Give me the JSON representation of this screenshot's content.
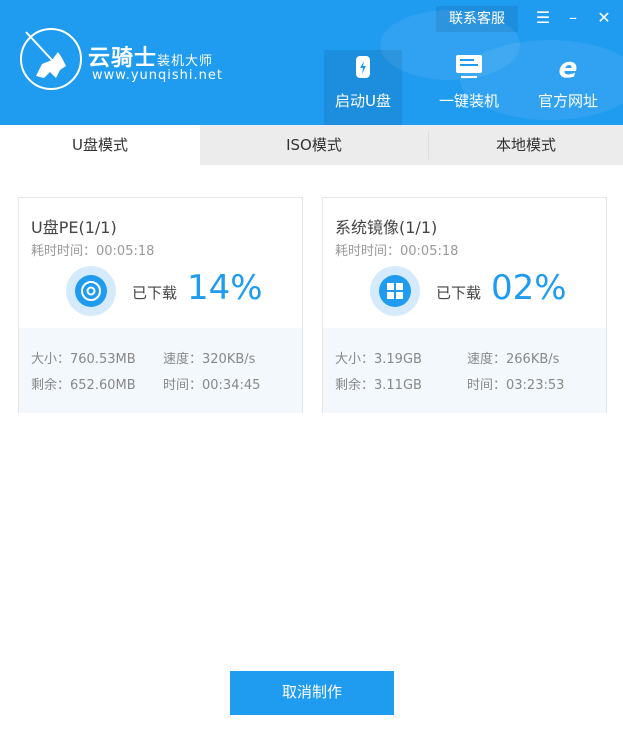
{
  "header": {
    "brand": "云骑士",
    "brand_sub": "装机大师",
    "url": "www.yunqishi.net",
    "service_label": "联系客服",
    "nav": [
      {
        "label": "启动U盘",
        "icon": "usb-icon",
        "active": true
      },
      {
        "label": "一键装机",
        "icon": "monitor-icon",
        "active": false
      },
      {
        "label": "官方网址",
        "icon": "ie-icon",
        "active": false
      }
    ]
  },
  "tabs": [
    "U盘模式",
    "ISO模式",
    "本地模式"
  ],
  "cards": [
    {
      "title": "U盘PE(1/1)",
      "elapsed": "耗时时间：00:05:18",
      "downloaded_label": "已下载",
      "percent": "14%",
      "size": "大小：760.53MB",
      "speed": "速度：320KB/s",
      "remaining": "剩余：652.60MB",
      "time": "时间：00:34:45"
    },
    {
      "title": "系统镜像(1/1)",
      "elapsed": "耗时时间：00:05:18",
      "downloaded_label": "已下载",
      "percent": "02%",
      "size": "大小：3.19GB",
      "speed": "速度：266KB/s",
      "remaining": "剩余：3.11GB",
      "time": "时间：03:23:53"
    }
  ],
  "cancel_label": "取消制作"
}
